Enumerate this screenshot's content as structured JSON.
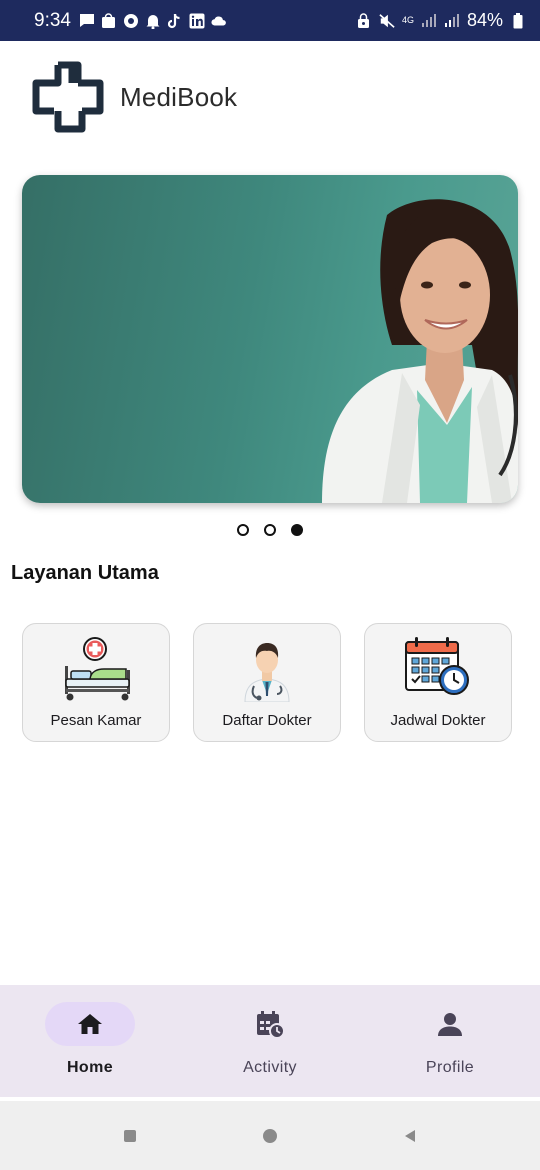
{
  "status_bar": {
    "time": "9:34",
    "battery_percent": "84%",
    "network": "4G",
    "left_icons": [
      "message-icon",
      "shopee-icon",
      "chrome-icon",
      "notification-bell-icon",
      "tiktok-icon",
      "linkedin-icon",
      "cloud-icon"
    ],
    "right_icons": [
      "lock-icon",
      "mute-icon",
      "network-4g-icon",
      "signal-icon",
      "signal-icon",
      "battery-icon"
    ]
  },
  "header": {
    "app_name": "MediBook"
  },
  "banner": {
    "slides": 3,
    "active_slide": 3
  },
  "section": {
    "title": "Layanan Utama"
  },
  "services": [
    {
      "label": "Pesan Kamar",
      "icon": "hospital-bed-icon"
    },
    {
      "label": "Daftar Dokter",
      "icon": "doctor-icon"
    },
    {
      "label": "Jadwal Dokter",
      "icon": "calendar-clock-icon"
    }
  ],
  "bottom_nav": [
    {
      "label": "Home",
      "icon": "home-icon",
      "active": true
    },
    {
      "label": "Activity",
      "icon": "calendar-activity-icon",
      "active": false
    },
    {
      "label": "Profile",
      "icon": "person-icon",
      "active": false
    }
  ],
  "colors": {
    "status_bar": "#1e2a5e",
    "nav_bg": "#ece6f1",
    "nav_pill": "#e4d8f7",
    "banner": "#3f887d"
  }
}
